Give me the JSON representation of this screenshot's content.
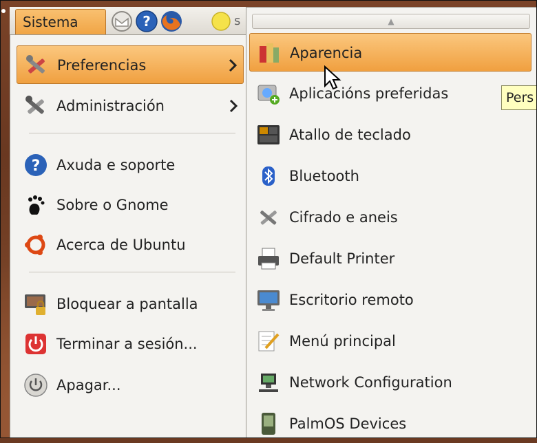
{
  "panel": {
    "menu_label": "Sistema"
  },
  "left_menu": {
    "items": [
      {
        "label": "Preferencias",
        "icon": "tools-icon"
      },
      {
        "label": "Administración",
        "icon": "admin-tools-icon"
      },
      {
        "label": "Axuda e soporte",
        "icon": "help-icon"
      },
      {
        "label": "Sobre o Gnome",
        "icon": "gnome-foot-icon"
      },
      {
        "label": "Acerca de Ubuntu",
        "icon": "ubuntu-icon"
      },
      {
        "label": "Bloquear a pantalla",
        "icon": "lock-screen-icon"
      },
      {
        "label": "Terminar a sesión...",
        "icon": "logout-icon"
      },
      {
        "label": "Apagar...",
        "icon": "power-icon"
      }
    ]
  },
  "submenu": {
    "items": [
      {
        "label": "Aparencia",
        "icon": "appearance-icon"
      },
      {
        "label": "Aplicacións preferidas",
        "icon": "preferred-apps-icon"
      },
      {
        "label": "Atallo de teclado",
        "icon": "keyboard-icon"
      },
      {
        "label": "Bluetooth",
        "icon": "bluetooth-icon"
      },
      {
        "label": "Cifrado e aneis",
        "icon": "encryption-icon"
      },
      {
        "label": "Default Printer",
        "icon": "printer-icon"
      },
      {
        "label": "Escritorio remoto",
        "icon": "remote-desktop-icon"
      },
      {
        "label": "Menú principal",
        "icon": "main-menu-icon"
      },
      {
        "label": "Network Configuration",
        "icon": "network-icon"
      },
      {
        "label": "PalmOS Devices",
        "icon": "palm-icon"
      }
    ]
  },
  "tooltip": {
    "text": "Pers"
  },
  "colors": {
    "highlight": "#f0a040",
    "menu_bg": "#f4f3f0"
  }
}
